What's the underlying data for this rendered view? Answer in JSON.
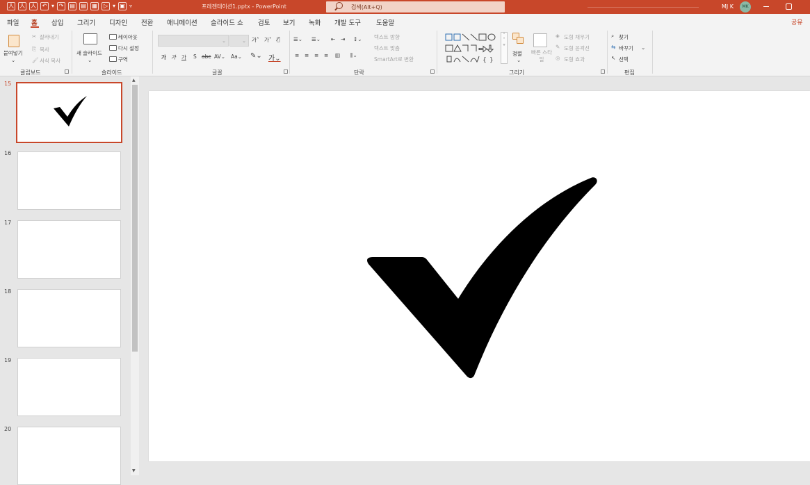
{
  "titlebar": {
    "document_title": "프레젠테이션1.pptx - PowerPoint",
    "search_placeholder": "검색(Alt+Q)",
    "user_name": "MJ K",
    "user_initials": "MK",
    "accent_color": "#c8472a"
  },
  "menu": {
    "items": [
      "파일",
      "홈",
      "삽입",
      "그리기",
      "디자인",
      "전환",
      "애니메이션",
      "슬라이드 쇼",
      "검토",
      "보기",
      "녹화",
      "개발 도구",
      "도움말"
    ],
    "active": "홈",
    "share_label": "공유"
  },
  "ribbon": {
    "clipboard": {
      "paste": "붙여넣기",
      "cut": "잘라내기",
      "copy": "복사",
      "format_painter": "서식 복사",
      "label": "클립보드"
    },
    "slides": {
      "new_slide": "새 슬라이드",
      "layout": "레이아웃",
      "reset": "다시 설정",
      "section": "구역",
      "label": "슬라이드"
    },
    "font": {
      "label": "글꼴"
    },
    "paragraph": {
      "text_direction": "텍스트 방향",
      "align_text": "텍스트 맞춤",
      "smartart": "SmartArt로 변환",
      "label": "단락"
    },
    "drawing": {
      "arrange": "정렬",
      "quick_styles": "빠른 스타일",
      "shape_fill": "도형 채우기",
      "shape_outline": "도형 윤곽선",
      "shape_effects": "도형 효과",
      "label": "그리기"
    },
    "editing": {
      "find": "찾기",
      "replace": "바꾸기",
      "select": "선택",
      "label": "편집"
    }
  },
  "slides": {
    "numbers": [
      "15",
      "16",
      "17",
      "18",
      "19",
      "20"
    ],
    "selected": "15",
    "current_slide_content": "checkmark-icon"
  }
}
